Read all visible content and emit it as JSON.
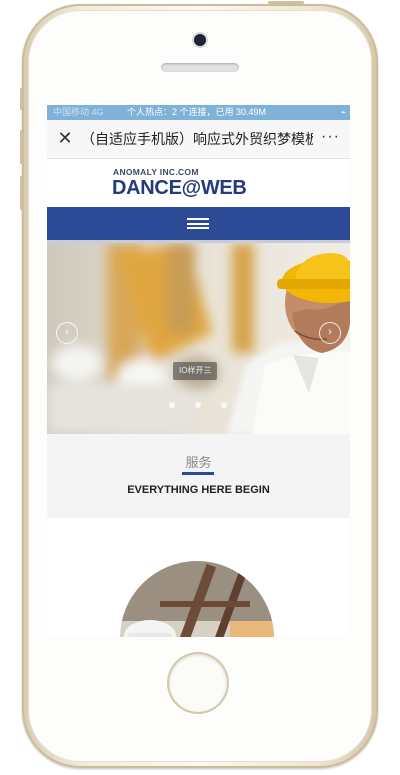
{
  "status_bar": {
    "left": "中国移动 4G",
    "center": "个人热点：2 个连接，已用 30.49M",
    "right": "⌁"
  },
  "nav_bar": {
    "close_label": "✕",
    "title": "（自适应手机版）响应式外贸织梦模板...",
    "more_label": "···"
  },
  "site_header": {
    "logo_small": "ANOMALY INC.COM",
    "logo_big": "DANCE@WEB"
  },
  "hero": {
    "badge_text": "IO样开三",
    "prev_label": "‹",
    "next_label": "›",
    "dot_count": 3
  },
  "services": {
    "title_zh": "服务",
    "subtitle_en": "EVERYTHING HERE BEGIN"
  },
  "colors": {
    "brand_blue": "#2c4a96",
    "status_blue": "#7fb2d8",
    "section_bg": "#f4f4f4"
  }
}
